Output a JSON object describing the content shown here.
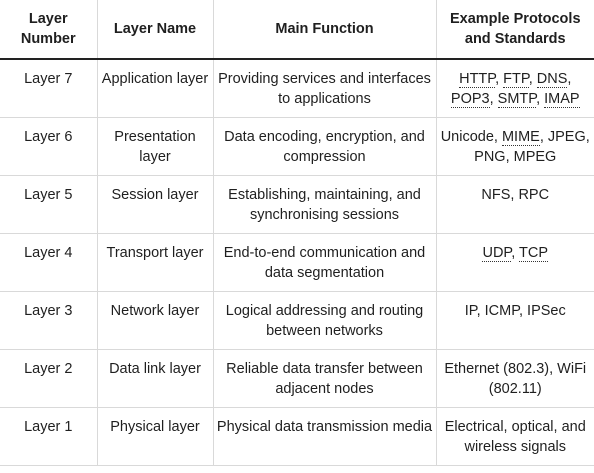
{
  "headers": {
    "layer_number": "Layer Number",
    "layer_name": "Layer Name",
    "main_function": "Main Function",
    "protocols": "Example Protocols and Standards"
  },
  "rows": [
    {
      "number": "Layer 7",
      "name": "Application layer",
      "function": "Providing services and interfaces to applications",
      "protocols": [
        {
          "text": "HTTP",
          "abbr": true
        },
        {
          "text": ", ",
          "abbr": false
        },
        {
          "text": "FTP",
          "abbr": true
        },
        {
          "text": ", ",
          "abbr": false
        },
        {
          "text": "DNS",
          "abbr": true
        },
        {
          "text": ", ",
          "abbr": false
        },
        {
          "text": "POP3",
          "abbr": true
        },
        {
          "text": ", ",
          "abbr": false
        },
        {
          "text": "SMTP",
          "abbr": true
        },
        {
          "text": ", ",
          "abbr": false
        },
        {
          "text": "IMAP",
          "abbr": true
        }
      ]
    },
    {
      "number": "Layer 6",
      "name": "Presentation layer",
      "function": "Data encoding, encryption, and compression",
      "protocols": [
        {
          "text": "Unicode, ",
          "abbr": false
        },
        {
          "text": "MIME",
          "abbr": true
        },
        {
          "text": ", JPEG, PNG, MPEG",
          "abbr": false
        }
      ]
    },
    {
      "number": "Layer 5",
      "name": "Session layer",
      "function": "Establishing, maintaining, and synchronising sessions",
      "protocols": [
        {
          "text": "NFS, RPC",
          "abbr": false
        }
      ]
    },
    {
      "number": "Layer 4",
      "name": "Transport layer",
      "function": "End-to-end communication and data segmentation",
      "protocols": [
        {
          "text": "UDP",
          "abbr": true
        },
        {
          "text": ", ",
          "abbr": false
        },
        {
          "text": "TCP",
          "abbr": true
        }
      ]
    },
    {
      "number": "Layer 3",
      "name": "Network layer",
      "function": "Logical addressing and routing between networks",
      "protocols": [
        {
          "text": "IP, ICMP, IPSec",
          "abbr": false
        }
      ]
    },
    {
      "number": "Layer 2",
      "name": "Data link layer",
      "function": "Reliable data transfer between adjacent nodes",
      "protocols": [
        {
          "text": "Ethernet (802.3), WiFi (802.11)",
          "abbr": false
        }
      ]
    },
    {
      "number": "Layer 1",
      "name": "Physical layer",
      "function": "Physical data transmission media",
      "protocols": [
        {
          "text": "Electrical, optical, and wireless signals",
          "abbr": false
        }
      ]
    }
  ]
}
